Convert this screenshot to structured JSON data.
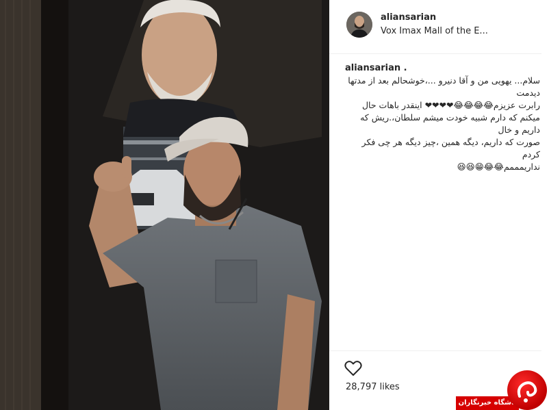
{
  "post": {
    "username": "aliansarian",
    "location": "Vox Imax Mall of the E...",
    "caption_user": "aliansarian .",
    "caption_lines": [
      "سلام... یهویی من و آقا دنیرو ...،خوشحالم بعد از مدتها دیدمت",
      "رابرت عزیزم😂😂😂😂❤❤❤❤ اینقدر باهات حال",
      "میکنم که دارم شبیه خودت میشم سلطان،.ریش که داریم و خال",
      "صورت که داریم، دیگه همین ،چیز دیگه هر چی فکر کردم",
      "نداریمممم😂😂😁😆😆"
    ],
    "likes": "28,797 likes"
  },
  "icons": {
    "heart": "heart-outline-icon",
    "watermark": "news-agency-logo"
  },
  "watermark": {
    "text": "باشگاه خبرنگاران"
  },
  "colors": {
    "text": "#262626",
    "divider": "#efefef",
    "watermark_red": "#d60000"
  }
}
